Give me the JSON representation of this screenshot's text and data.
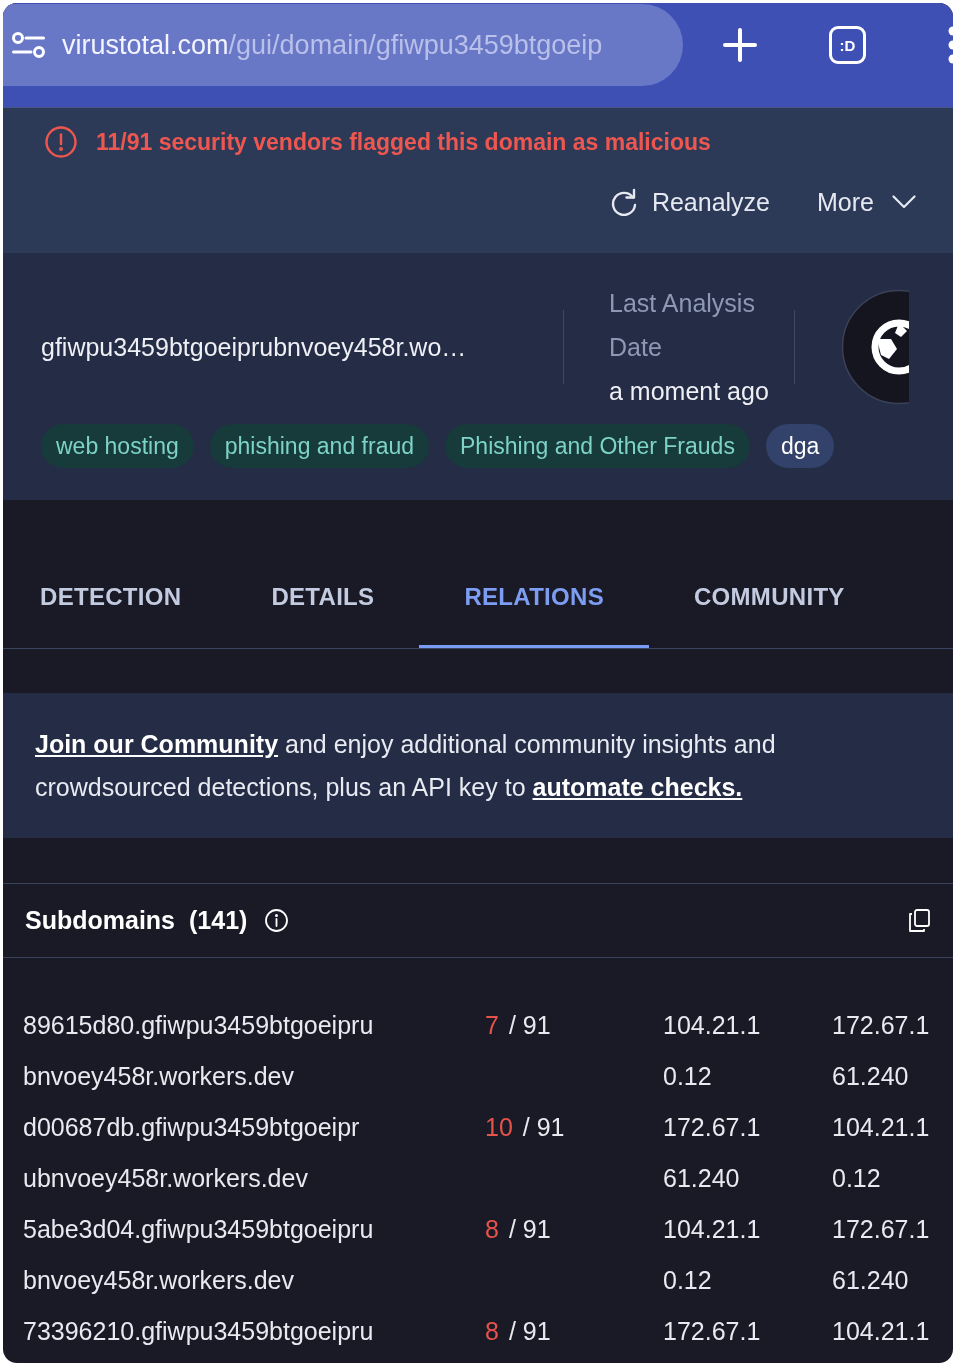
{
  "browser_bar": {
    "url_host": "virustotal.com",
    "url_path": "/gui/domain/gfiwpu3459btgoeip",
    "tab_count": ":D"
  },
  "alert": {
    "message": "11/91 security vendors flagged this domain as malicious",
    "actions": [
      {
        "label": "Reanalyze",
        "kind": "refresh"
      },
      {
        "label": "More",
        "kind": "dropdown"
      }
    ]
  },
  "domain": {
    "name": "gfiwpu3459btgoeiprubnvoey458r.wo…",
    "last_analysis_label": "Last Analysis Date",
    "last_analysis_value": "a moment ago",
    "tags": [
      {
        "label": "web hosting",
        "kind": "category"
      },
      {
        "label": "phishing and fraud",
        "kind": "category"
      },
      {
        "label": "Phishing and Other Frauds",
        "kind": "category"
      },
      {
        "label": "dga",
        "kind": "tag"
      }
    ]
  },
  "tabs": [
    {
      "label": "DETECTION",
      "selected": false
    },
    {
      "label": "DETAILS",
      "selected": false
    },
    {
      "label": "RELATIONS",
      "selected": true
    },
    {
      "label": "COMMUNITY",
      "selected": false
    }
  ],
  "banner": {
    "parts": [
      {
        "kind": "link",
        "text": "Join our Community"
      },
      {
        "kind": "text",
        "text": " and enjoy additional community insights and crowdsourced detections, plus an API key to "
      },
      {
        "kind": "link",
        "text": "automate checks."
      }
    ]
  },
  "subdomains": {
    "title": "Subdomains",
    "count": "(141)",
    "rows": [
      {
        "name": [
          "89615d80.gfiwpu3459btgoeipru",
          "bnvoey458r.workers.dev"
        ],
        "detections": "7",
        "total": "/ 91",
        "column_3": [
          "104.21.1",
          "0.12"
        ],
        "column_4": [
          "172.67.1",
          "61.240"
        ]
      },
      {
        "name": [
          "d00687db.gfiwpu3459btgoeipr",
          "ubnvoey458r.workers.dev"
        ],
        "detections": "10",
        "total": "/ 91",
        "column_3": [
          "172.67.1",
          "61.240"
        ],
        "column_4": [
          "104.21.1",
          "0.12"
        ]
      },
      {
        "name": [
          "5abe3d04.gfiwpu3459btgoeipru",
          "bnvoey458r.workers.dev"
        ],
        "detections": "8",
        "total": "/ 91",
        "column_3": [
          "104.21.1",
          "0.12"
        ],
        "column_4": [
          "172.67.1",
          "61.240"
        ]
      },
      {
        "name": [
          "73396210.gfiwpu3459btgoeipru"
        ],
        "detections": "8",
        "total": "/ 91",
        "column_3": [
          "172.67.1"
        ],
        "column_4": [
          "104.21.1"
        ]
      }
    ]
  }
}
